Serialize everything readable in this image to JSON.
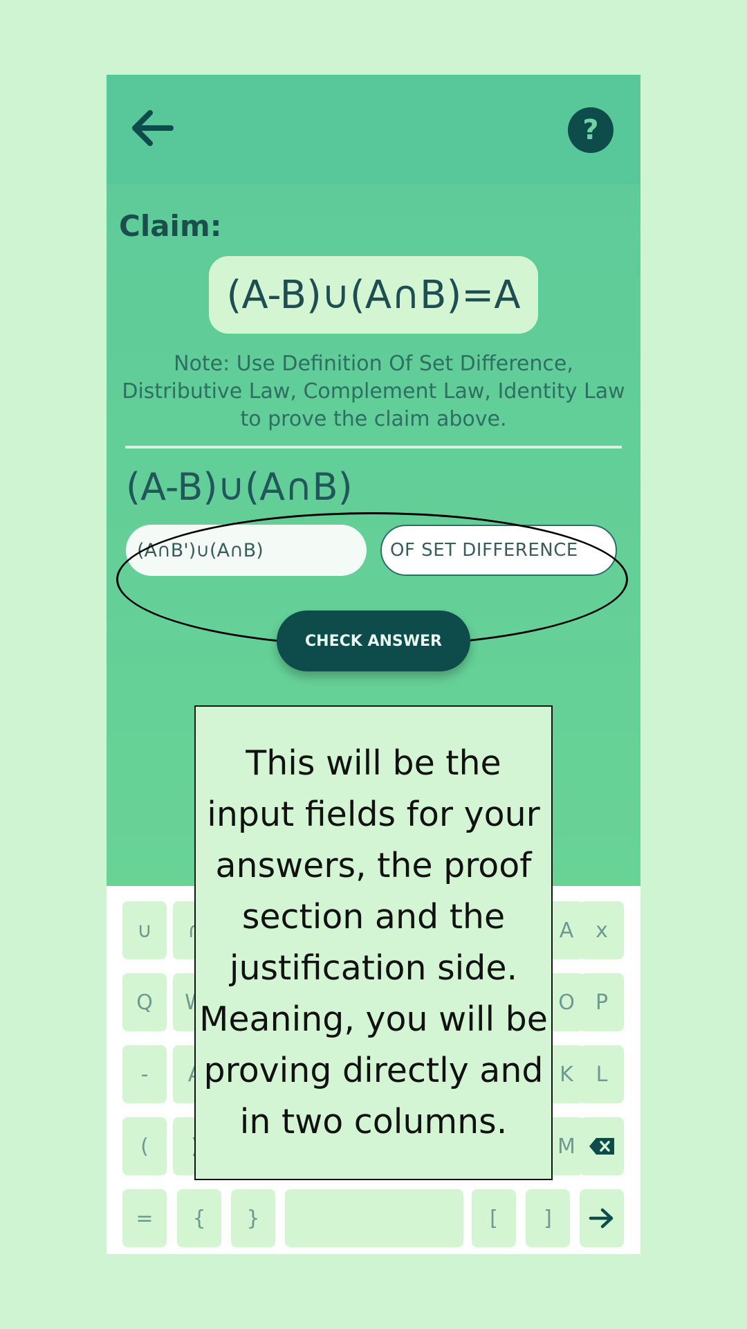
{
  "appbar": {
    "back_icon": "arrow-left-icon",
    "help_icon": "question-icon",
    "help_glyph": "?"
  },
  "claim": {
    "label": "Claim:",
    "expression": "(A-B)∪(A∩B)=A",
    "note": "Note: Use Definition Of Set Difference, Distributive Law, Complement Law, Identity Law to prove the claim above."
  },
  "proof": {
    "step_expression": "(A-B)∪(A∩B)",
    "answer_value": "(A∩B')∪(A∩B)",
    "justification_value": "OF SET DIFFERENCE",
    "check_button": "CHECK ANSWER"
  },
  "tooltip": {
    "text": "This will be the input fields for your answers, the proof section and the justification side. Meaning, you will be proving directly and in two columns."
  },
  "keyboard": {
    "row1_left": [
      "∪",
      "∩"
    ],
    "row1_right": [
      "A",
      "x"
    ],
    "row2_left": [
      "Q",
      "W"
    ],
    "row2_right": [
      "O",
      "P"
    ],
    "row3_left": [
      "-",
      "A"
    ],
    "row3_right": [
      "K",
      "L"
    ],
    "row4_left": [
      "(",
      ")"
    ],
    "row4_right": [
      "M"
    ],
    "row5": [
      "=",
      "{",
      "}",
      "",
      "[",
      "]"
    ],
    "backspace_icon": "backspace-icon",
    "enter_icon": "arrow-right-icon"
  },
  "colors": {
    "page_bg": "#cff4d2",
    "appbar": "#58c79a",
    "accent_dark": "#0d4c4b",
    "key_bg": "#d4f5d2",
    "tooltip_bg": "#d4f5d3"
  }
}
